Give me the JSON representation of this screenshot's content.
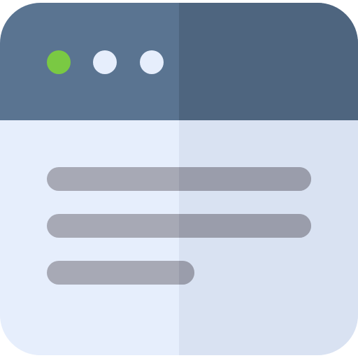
{
  "icon": {
    "name": "browser-window-icon",
    "colors": {
      "header_left": "#5a7491",
      "header_right": "#4e657f",
      "body_left": "#e6eefc",
      "body_right": "#d9e2f2",
      "dot_active": "#7ac943",
      "dot_idle": "#e6eefc",
      "line_left": "#a7a9b5",
      "line_right": "#9a9dab"
    }
  }
}
